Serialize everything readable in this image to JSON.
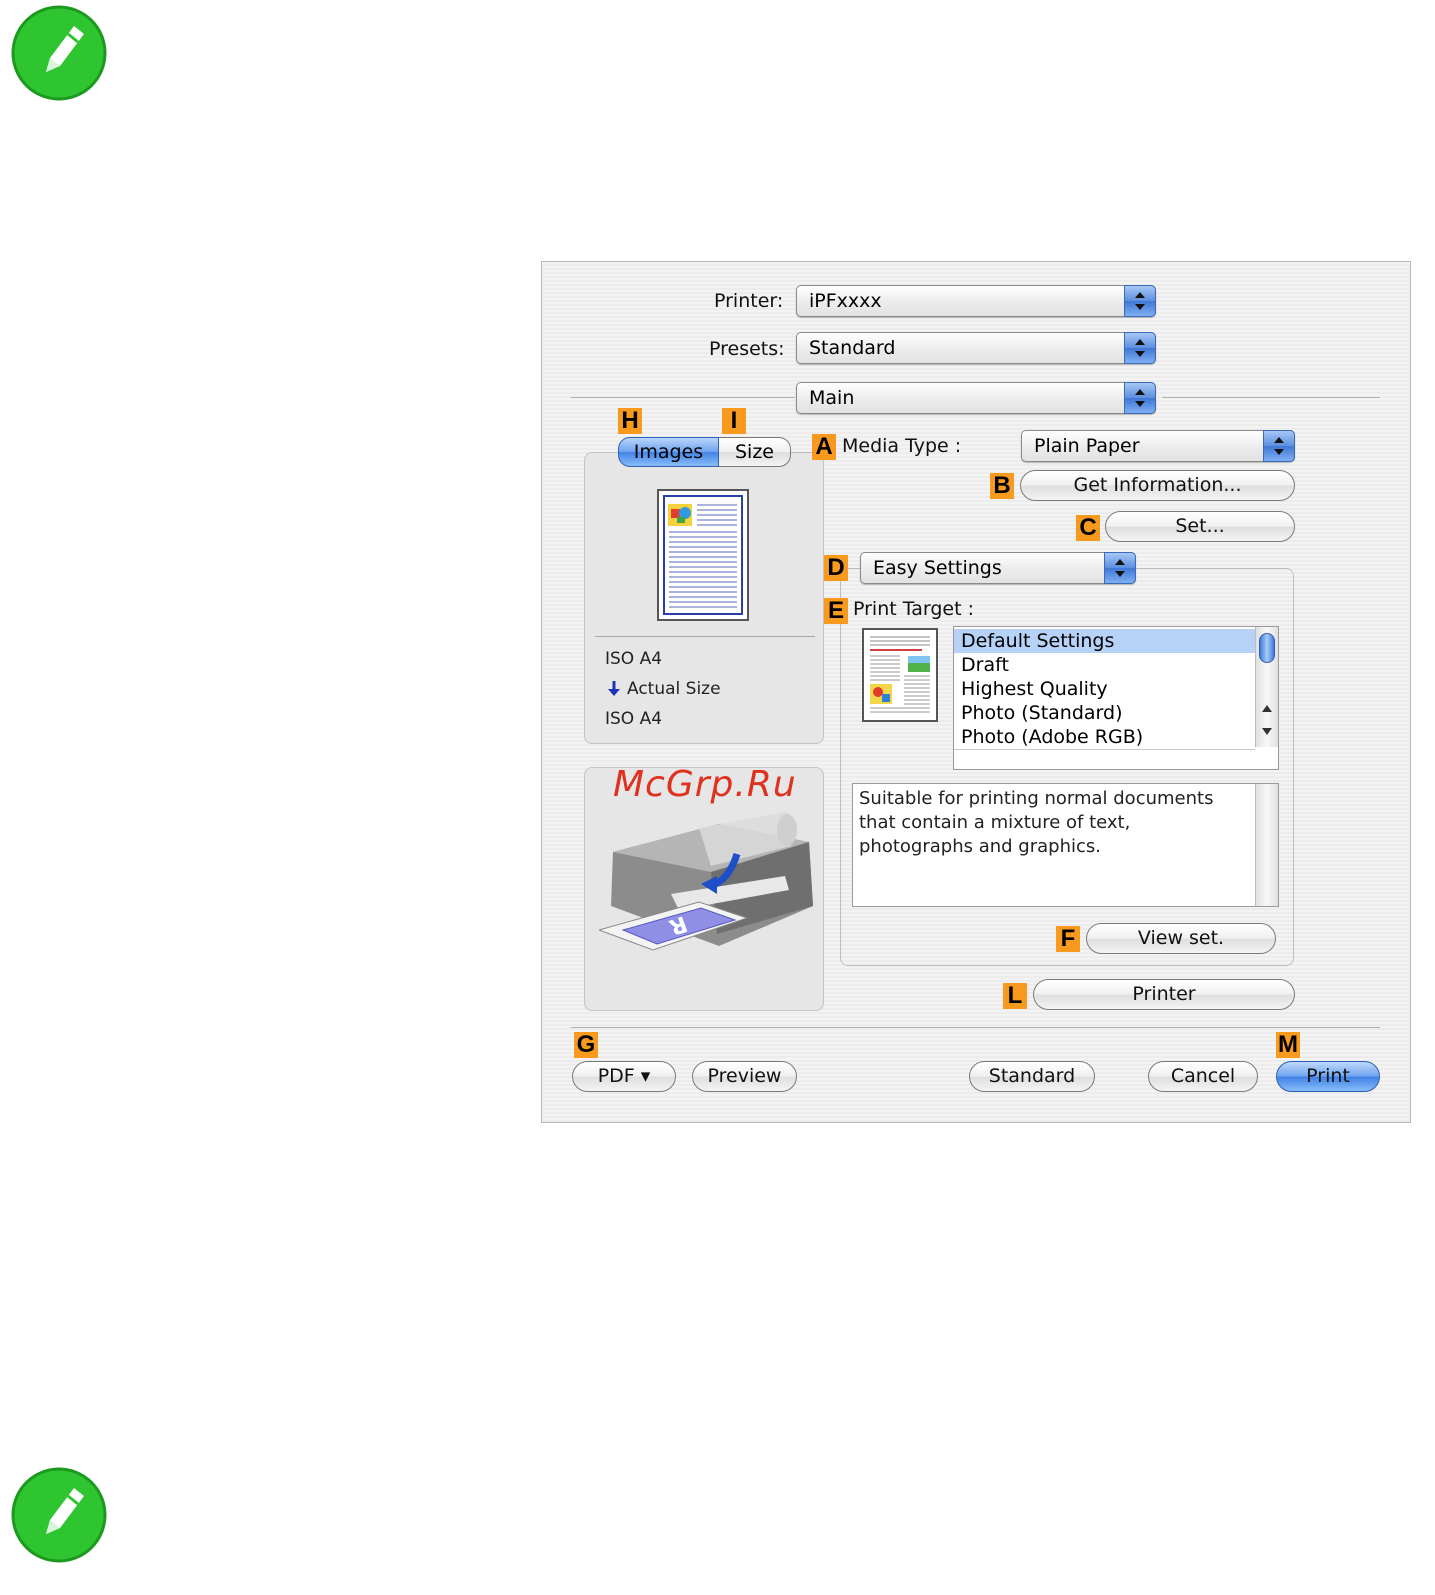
{
  "dialog": {
    "printer_label": "Printer:",
    "printer_value": "iPFxxxx",
    "presets_label": "Presets:",
    "presets_value": "Standard",
    "panel_value": "Main",
    "tabs": {
      "images": "Images",
      "size": "Size"
    },
    "preview_info": [
      "ISO A4",
      "Actual Size",
      "ISO A4"
    ],
    "watermark": "McGrp.Ru",
    "media_type_label": "Media Type :",
    "media_type_value": "Plain Paper",
    "get_info_label": "Get Information...",
    "set_label": "Set...",
    "mode_value": "Easy Settings",
    "print_target_label": "Print Target :",
    "print_targets": [
      "Default Settings",
      "Draft",
      "Highest Quality",
      "Photo (Standard)",
      "Photo (Adobe RGB)"
    ],
    "selected_target_index": 0,
    "description": "Suitable for printing normal documents that contain a mixture of text, photographs and graphics.",
    "view_set_label": "View set.",
    "printer_button_label": "Printer",
    "bottom_buttons": {
      "pdf": "PDF ▾",
      "preview": "Preview",
      "standard": "Standard",
      "cancel": "Cancel",
      "print": "Print"
    }
  },
  "badges": {
    "a": "A",
    "b": "B",
    "c": "C",
    "d": "D",
    "e": "E",
    "f": "F",
    "g": "G",
    "h": "H",
    "i": "I",
    "l": "L",
    "m": "M"
  },
  "colors": {
    "badge": "#f79a1d",
    "selection": "#b6d2f6",
    "aqua_blue": "#4283e6",
    "note_green": "#2ec531"
  }
}
